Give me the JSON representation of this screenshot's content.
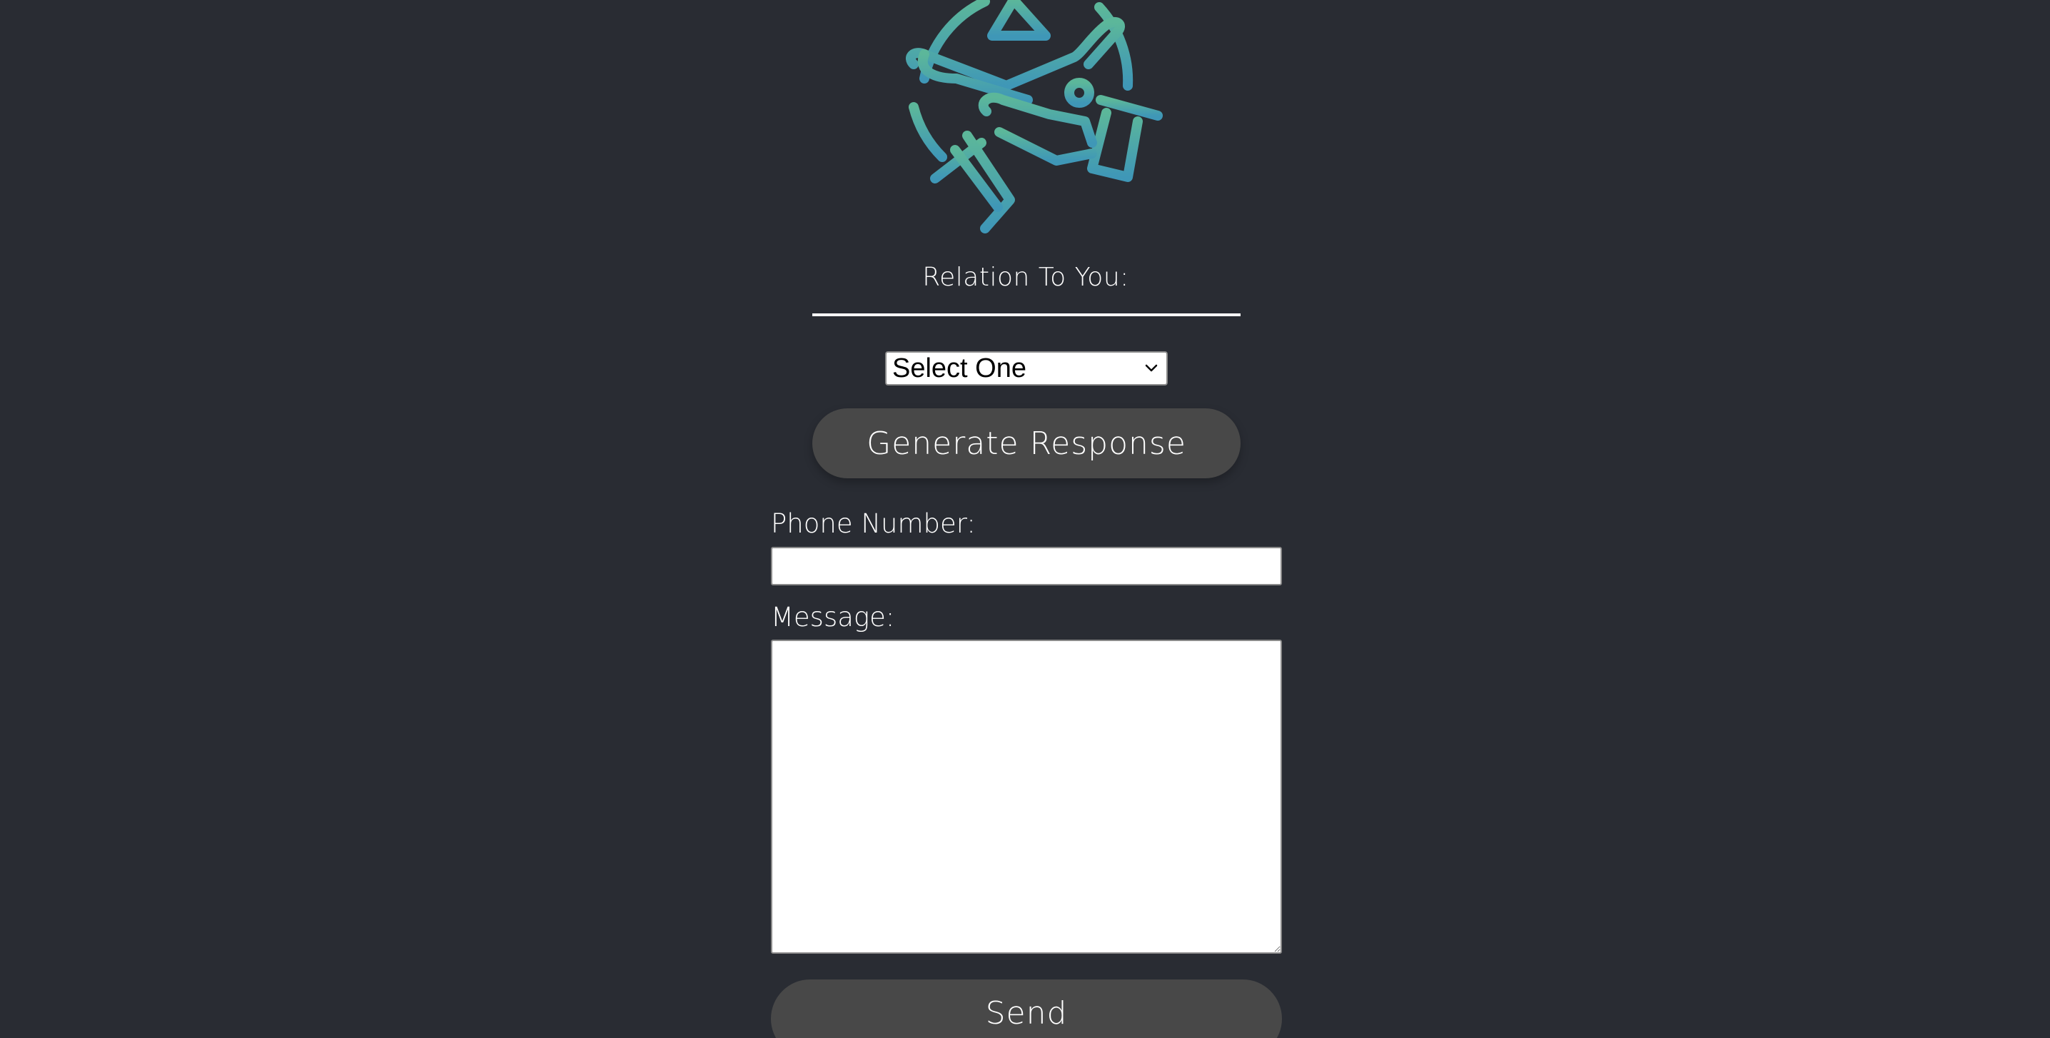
{
  "header": {
    "logo_icon": "hands-crossed-warning-icon",
    "logo_gradient": [
      "#5cb79a",
      "#3f97b7"
    ]
  },
  "relation": {
    "label": "Relation To You:",
    "select_value": "Select One"
  },
  "generate_button": {
    "label": "Generate Response"
  },
  "phone": {
    "label": "Phone Number:",
    "value": "",
    "placeholder": ""
  },
  "message": {
    "label": "Message:",
    "value": "",
    "placeholder": ""
  },
  "send_button": {
    "label": "Send"
  },
  "colors": {
    "background": "#292c33",
    "button": "#484848",
    "text": "#ffffff"
  }
}
